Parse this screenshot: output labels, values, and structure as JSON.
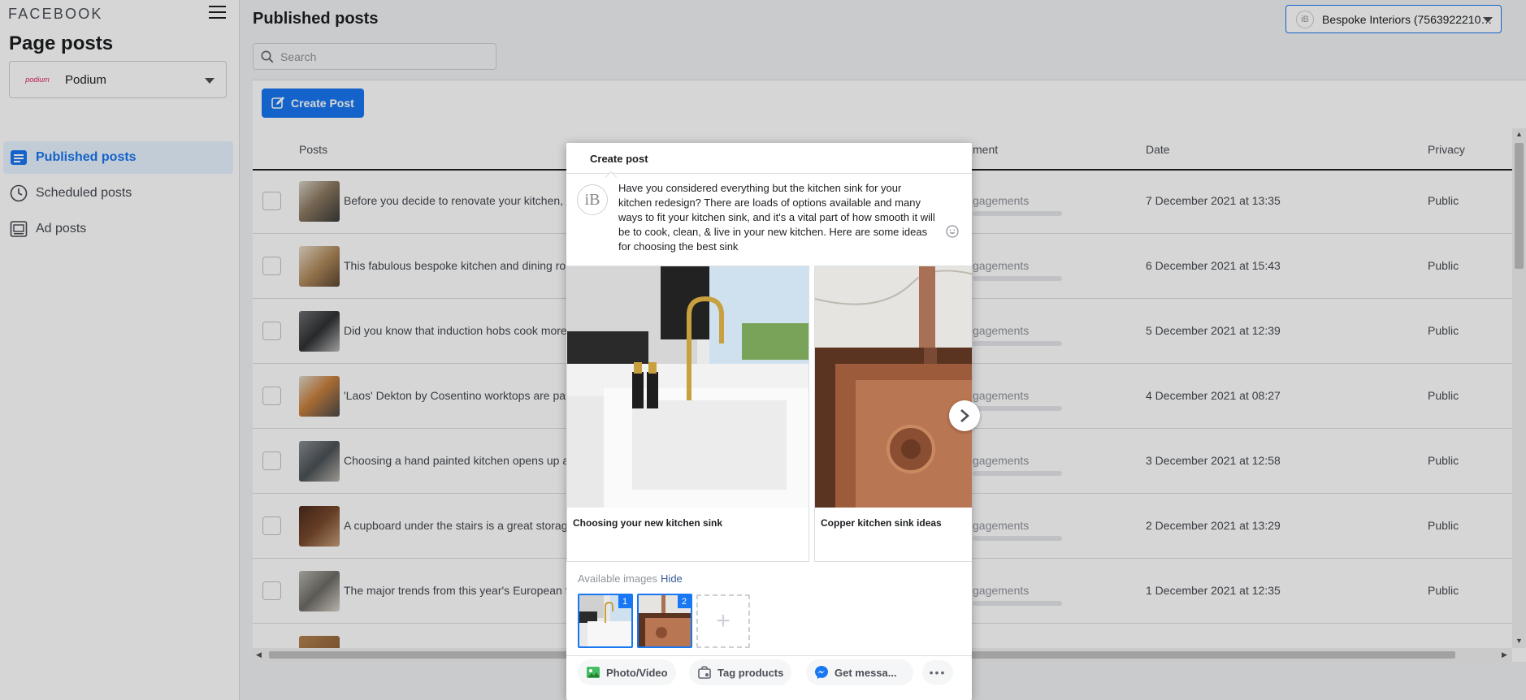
{
  "brand": "FACEBOOK",
  "sidebar": {
    "heading": "Page posts",
    "page_select": {
      "value": "Podium",
      "logo_text": "podium"
    },
    "items": [
      {
        "label": "Published posts",
        "active": true,
        "icon": "list-icon"
      },
      {
        "label": "Scheduled posts",
        "active": false,
        "icon": "clock-icon"
      },
      {
        "label": "Ad posts",
        "active": false,
        "icon": "ad-icon"
      }
    ]
  },
  "header": {
    "title": "Published posts",
    "account_select": "Bespoke Interiors (75639222108..."
  },
  "search": {
    "placeholder": "Search"
  },
  "toolbar": {
    "create_label": "Create Post"
  },
  "table": {
    "columns": {
      "posts": "Posts",
      "engagement": "ment",
      "date": "Date",
      "privacy": "Privacy"
    },
    "engagement_text": "gagements",
    "rows": [
      {
        "text": "Before you decide to renovate your kitchen, c",
        "date": "7 December 2021 at 13:35",
        "privacy": "Public"
      },
      {
        "text": "This fabulous bespoke kitchen and dining ro",
        "date": "6 December 2021 at 15:43",
        "privacy": "Public"
      },
      {
        "text": "Did you know that induction hobs cook more",
        "date": "5 December 2021 at 12:39",
        "privacy": "Public"
      },
      {
        "text": "'Laos' Dekton by Cosentino worktops are par",
        "date": "4 December 2021 at 08:27",
        "privacy": "Public"
      },
      {
        "text": "Choosing a hand painted kitchen opens up a",
        "date": "3 December 2021 at 12:58",
        "privacy": "Public"
      },
      {
        "text": "A cupboard under the stairs is a great storag",
        "date": "2 December 2021 at 13:29",
        "privacy": "Public"
      },
      {
        "text": "The major trends from this year's European f",
        "date": "1 December 2021 at 12:35",
        "privacy": "Public"
      }
    ]
  },
  "modal": {
    "title": "Create post",
    "avatar_text": "iB",
    "text": "Have you considered everything but the kitchen sink for your kitchen redesign? There are loads of options available and many ways to fit your kitchen sink, and it's a vital part of how smooth it will be to cook, clean, & live in your new kitchen. Here are some ideas for choosing the best sink",
    "cards": [
      {
        "title": "Choosing your new kitchen sink"
      },
      {
        "title": "Copper kitchen sink ideas"
      }
    ],
    "available_images_label": "Available images",
    "hide_label": "Hide",
    "image_numbers": [
      "1",
      "2"
    ],
    "add_symbol": "+",
    "actions": {
      "photo_video": "Photo/Video",
      "tag_products": "Tag products",
      "get_messages": "Get messa...",
      "more": "•••"
    }
  },
  "colors": {
    "accent": "#1877f2",
    "overlay": "rgba(0,0,0,0.16)"
  }
}
